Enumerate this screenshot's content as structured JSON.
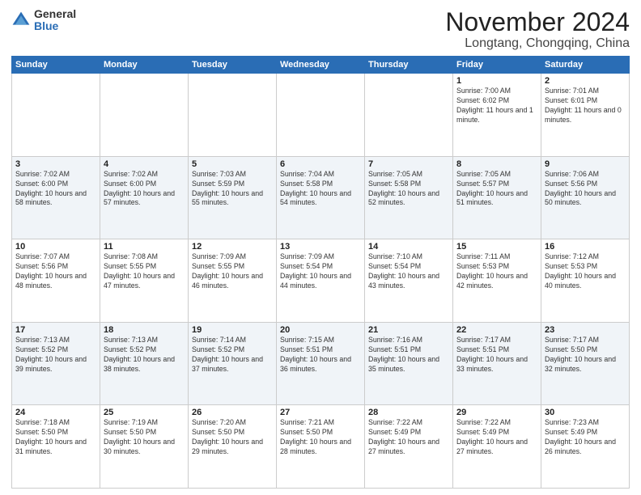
{
  "logo": {
    "general": "General",
    "blue": "Blue"
  },
  "header": {
    "month": "November 2024",
    "location": "Longtang, Chongqing, China"
  },
  "weekdays": [
    "Sunday",
    "Monday",
    "Tuesday",
    "Wednesday",
    "Thursday",
    "Friday",
    "Saturday"
  ],
  "weeks": [
    [
      {
        "day": "",
        "info": ""
      },
      {
        "day": "",
        "info": ""
      },
      {
        "day": "",
        "info": ""
      },
      {
        "day": "",
        "info": ""
      },
      {
        "day": "",
        "info": ""
      },
      {
        "day": "1",
        "info": "Sunrise: 7:00 AM\nSunset: 6:02 PM\nDaylight: 11 hours and 1 minute."
      },
      {
        "day": "2",
        "info": "Sunrise: 7:01 AM\nSunset: 6:01 PM\nDaylight: 11 hours and 0 minutes."
      }
    ],
    [
      {
        "day": "3",
        "info": "Sunrise: 7:02 AM\nSunset: 6:00 PM\nDaylight: 10 hours and 58 minutes."
      },
      {
        "day": "4",
        "info": "Sunrise: 7:02 AM\nSunset: 6:00 PM\nDaylight: 10 hours and 57 minutes."
      },
      {
        "day": "5",
        "info": "Sunrise: 7:03 AM\nSunset: 5:59 PM\nDaylight: 10 hours and 55 minutes."
      },
      {
        "day": "6",
        "info": "Sunrise: 7:04 AM\nSunset: 5:58 PM\nDaylight: 10 hours and 54 minutes."
      },
      {
        "day": "7",
        "info": "Sunrise: 7:05 AM\nSunset: 5:58 PM\nDaylight: 10 hours and 52 minutes."
      },
      {
        "day": "8",
        "info": "Sunrise: 7:05 AM\nSunset: 5:57 PM\nDaylight: 10 hours and 51 minutes."
      },
      {
        "day": "9",
        "info": "Sunrise: 7:06 AM\nSunset: 5:56 PM\nDaylight: 10 hours and 50 minutes."
      }
    ],
    [
      {
        "day": "10",
        "info": "Sunrise: 7:07 AM\nSunset: 5:56 PM\nDaylight: 10 hours and 48 minutes."
      },
      {
        "day": "11",
        "info": "Sunrise: 7:08 AM\nSunset: 5:55 PM\nDaylight: 10 hours and 47 minutes."
      },
      {
        "day": "12",
        "info": "Sunrise: 7:09 AM\nSunset: 5:55 PM\nDaylight: 10 hours and 46 minutes."
      },
      {
        "day": "13",
        "info": "Sunrise: 7:09 AM\nSunset: 5:54 PM\nDaylight: 10 hours and 44 minutes."
      },
      {
        "day": "14",
        "info": "Sunrise: 7:10 AM\nSunset: 5:54 PM\nDaylight: 10 hours and 43 minutes."
      },
      {
        "day": "15",
        "info": "Sunrise: 7:11 AM\nSunset: 5:53 PM\nDaylight: 10 hours and 42 minutes."
      },
      {
        "day": "16",
        "info": "Sunrise: 7:12 AM\nSunset: 5:53 PM\nDaylight: 10 hours and 40 minutes."
      }
    ],
    [
      {
        "day": "17",
        "info": "Sunrise: 7:13 AM\nSunset: 5:52 PM\nDaylight: 10 hours and 39 minutes."
      },
      {
        "day": "18",
        "info": "Sunrise: 7:13 AM\nSunset: 5:52 PM\nDaylight: 10 hours and 38 minutes."
      },
      {
        "day": "19",
        "info": "Sunrise: 7:14 AM\nSunset: 5:52 PM\nDaylight: 10 hours and 37 minutes."
      },
      {
        "day": "20",
        "info": "Sunrise: 7:15 AM\nSunset: 5:51 PM\nDaylight: 10 hours and 36 minutes."
      },
      {
        "day": "21",
        "info": "Sunrise: 7:16 AM\nSunset: 5:51 PM\nDaylight: 10 hours and 35 minutes."
      },
      {
        "day": "22",
        "info": "Sunrise: 7:17 AM\nSunset: 5:51 PM\nDaylight: 10 hours and 33 minutes."
      },
      {
        "day": "23",
        "info": "Sunrise: 7:17 AM\nSunset: 5:50 PM\nDaylight: 10 hours and 32 minutes."
      }
    ],
    [
      {
        "day": "24",
        "info": "Sunrise: 7:18 AM\nSunset: 5:50 PM\nDaylight: 10 hours and 31 minutes."
      },
      {
        "day": "25",
        "info": "Sunrise: 7:19 AM\nSunset: 5:50 PM\nDaylight: 10 hours and 30 minutes."
      },
      {
        "day": "26",
        "info": "Sunrise: 7:20 AM\nSunset: 5:50 PM\nDaylight: 10 hours and 29 minutes."
      },
      {
        "day": "27",
        "info": "Sunrise: 7:21 AM\nSunset: 5:50 PM\nDaylight: 10 hours and 28 minutes."
      },
      {
        "day": "28",
        "info": "Sunrise: 7:22 AM\nSunset: 5:49 PM\nDaylight: 10 hours and 27 minutes."
      },
      {
        "day": "29",
        "info": "Sunrise: 7:22 AM\nSunset: 5:49 PM\nDaylight: 10 hours and 27 minutes."
      },
      {
        "day": "30",
        "info": "Sunrise: 7:23 AM\nSunset: 5:49 PM\nDaylight: 10 hours and 26 minutes."
      }
    ]
  ]
}
